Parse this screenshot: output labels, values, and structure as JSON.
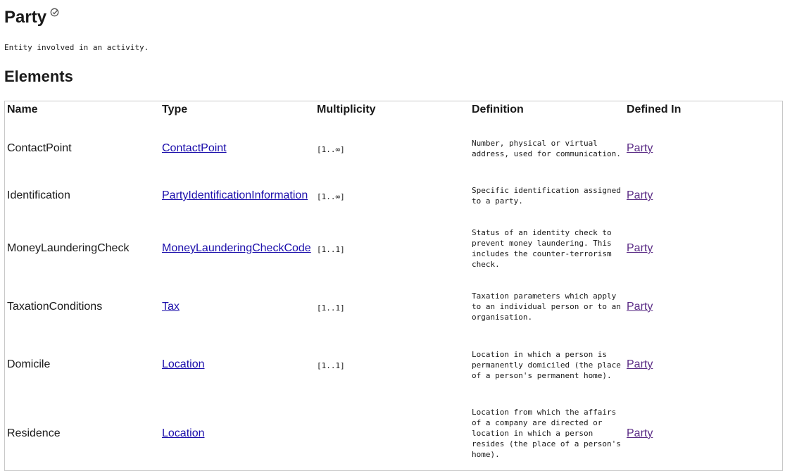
{
  "page": {
    "title": "Party",
    "description": "Entity involved in an activity.",
    "section_title": "Elements"
  },
  "icons": {
    "verified": "check-circle-icon"
  },
  "table": {
    "headers": {
      "name": "Name",
      "type": "Type",
      "multiplicity": "Multiplicity",
      "definition": "Definition",
      "defined_in": "Defined In"
    },
    "rows": [
      {
        "name": "ContactPoint",
        "type": "ContactPoint",
        "multiplicity": "[1..∞]",
        "definition": "Number, physical or virtual address, used for communication.",
        "defined_in": "Party"
      },
      {
        "name": "Identification",
        "type": "PartyIdentificationInformation",
        "multiplicity": "[1..∞]",
        "definition": "Specific identification assigned to a party.",
        "defined_in": "Party"
      },
      {
        "name": "MoneyLaunderingCheck",
        "type": "MoneyLaunderingCheckCode",
        "multiplicity": "[1..1]",
        "definition": "Status of an identity check to prevent money laundering. This includes the counter-terrorism check.",
        "defined_in": "Party"
      },
      {
        "name": "TaxationConditions",
        "type": "Tax",
        "multiplicity": "[1..1]",
        "definition": "Taxation parameters which apply to an individual person or to an organisation.",
        "defined_in": "Party"
      },
      {
        "name": "Domicile",
        "type": "Location",
        "multiplicity": "[1..1]",
        "definition": "Location in which a person is permanently domiciled (the place of a person's permanent home).",
        "defined_in": "Party"
      },
      {
        "name": "Residence",
        "type": "Location",
        "multiplicity": "",
        "definition": "Location from which the affairs of a company are directed or location in which a person resides (the place of a person's home).",
        "defined_in": "Party"
      }
    ]
  },
  "colors": {
    "link": "#1a0dab",
    "visited_link": "#5b2c86",
    "table_border": "#c8c8c8",
    "text": "#1a1a1a"
  }
}
